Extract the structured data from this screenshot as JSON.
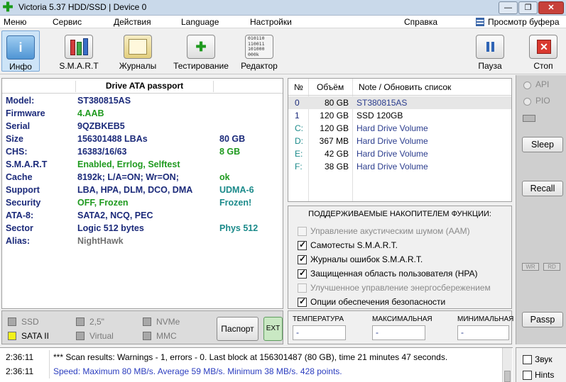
{
  "window": {
    "title": "Victoria 5.37 HDD/SSD | Device 0",
    "min_glyph": "—",
    "max_glyph": "❐",
    "close_glyph": "✕"
  },
  "menu": {
    "items": [
      "Меню",
      "Сервис",
      "Действия",
      "Language",
      "Настройки",
      "Справка"
    ],
    "buffer_view": "Просмотр буфера"
  },
  "toolbar": {
    "info": "Инфо",
    "smart": "S.M.A.R.T",
    "logs": "Журналы",
    "testing": "Тестирование",
    "editor": "Редактор",
    "pause": "Пауза",
    "stop": "Стоп",
    "editor_bits": "010110\n110011\n101000\n000k"
  },
  "passport": {
    "title": "Drive ATA passport",
    "rows": [
      {
        "key": "Model:",
        "value": "ST380815AS",
        "extra": ""
      },
      {
        "key": "Firmware",
        "value": "4.AAB",
        "extra": ""
      },
      {
        "key": "Serial",
        "value": "9QZBKEB5",
        "extra": ""
      },
      {
        "key": "Size",
        "value": "156301488 LBAs",
        "extra": "80 GB"
      },
      {
        "key": "CHS:",
        "value": "16383/16/63",
        "extra": "8 GB"
      },
      {
        "key": "S.M.A.R.T",
        "value": "Enabled, Errlog, Selftest",
        "extra": ""
      },
      {
        "key": "Cache",
        "value": "8192k; L/A=ON; Wr=ON;",
        "extra": "ok"
      },
      {
        "key": "Support",
        "value": "LBA, HPA, DLM, DCO, DMA",
        "extra": "UDMA-6"
      },
      {
        "key": "Security",
        "value": "OFF, Frozen",
        "extra": "Frozen!"
      },
      {
        "key": "ATA-8:",
        "value": "SATA2, NCQ, PEC",
        "extra": ""
      },
      {
        "key": "Sector",
        "value": "Logic 512 bytes",
        "extra": "Phys 512"
      },
      {
        "key": "Alias:",
        "value": "NightHawk",
        "extra": ""
      }
    ],
    "colors": {
      "label": "#1b2a7a",
      "green": "#1f9a1f",
      "teal": "#1b8a8a",
      "gray": "#707070"
    }
  },
  "devices": {
    "headers": {
      "num": "№",
      "volume": "Объём",
      "note": "Note / Обновить список"
    },
    "rows": [
      {
        "num": "0",
        "volume": "80 GB",
        "note": "ST380815AS"
      },
      {
        "num": "1",
        "volume": "120 GB",
        "note": "SSD 120GB"
      },
      {
        "num": "C:",
        "volume": "120 GB",
        "note": "Hard Drive Volume"
      },
      {
        "num": "D:",
        "volume": "367 MB",
        "note": "Hard Drive Volume"
      },
      {
        "num": "E:",
        "volume": "42 GB",
        "note": "Hard Drive Volume"
      },
      {
        "num": "F:",
        "volume": "38 GB",
        "note": "Hard Drive Volume"
      }
    ]
  },
  "features": {
    "title": "ПОДДЕРЖИВАЕМЫЕ НАКОПИТЕЛЕМ ФУНКЦИИ:",
    "items": [
      {
        "label": "Управление акустическим шумом (AAM)",
        "checked": false,
        "enabled": false
      },
      {
        "label": "Самотесты S.M.A.R.T.",
        "checked": true,
        "enabled": true
      },
      {
        "label": "Журналы ошибок S.M.A.R.T.",
        "checked": true,
        "enabled": true
      },
      {
        "label": "Защищенная область пользователя (HPA)",
        "checked": true,
        "enabled": true
      },
      {
        "label": "Улучшенное управление энергосбережением",
        "checked": false,
        "enabled": false
      },
      {
        "label": "Опции обеспечения безопасности",
        "checked": true,
        "enabled": true
      }
    ]
  },
  "side": {
    "api": "API",
    "pio": "PIO",
    "sleep": "Sleep",
    "recall": "Recall",
    "wr": "WR",
    "rd": "RD",
    "passp": "Passp"
  },
  "device_type": {
    "ssd": "SSD",
    "hdd25": "2,5\"",
    "nvme": "NVMe",
    "sata2": "SATA II",
    "virtual": "Virtual",
    "mmc": "MMC",
    "sata2_color": "#f2f21a",
    "passport_btn": "Паспорт",
    "ext_btn": "EXT"
  },
  "temperature": {
    "current_label": "ТЕМПЕРАТУРА",
    "max_label": "МАКСИМАЛЬНАЯ",
    "min_label": "МИНИМАЛЬНАЯ",
    "current_value": "-",
    "max_value": "-",
    "min_value": "-"
  },
  "log": {
    "entries": [
      {
        "time": "2:36:11",
        "message": "*** Scan results: Warnings - 1, errors - 0. Last block at 156301487 (80 GB), time 21 minutes 47 seconds.",
        "color": "#000000"
      },
      {
        "time": "2:36:11",
        "message": "Speed: Maximum 80 MB/s. Average 59 MB/s. Minimum 38 MB/s. 428 points.",
        "color": "#2b3dbf"
      }
    ]
  },
  "bottom_options": {
    "sound": "Звук",
    "hints": "Hints"
  }
}
